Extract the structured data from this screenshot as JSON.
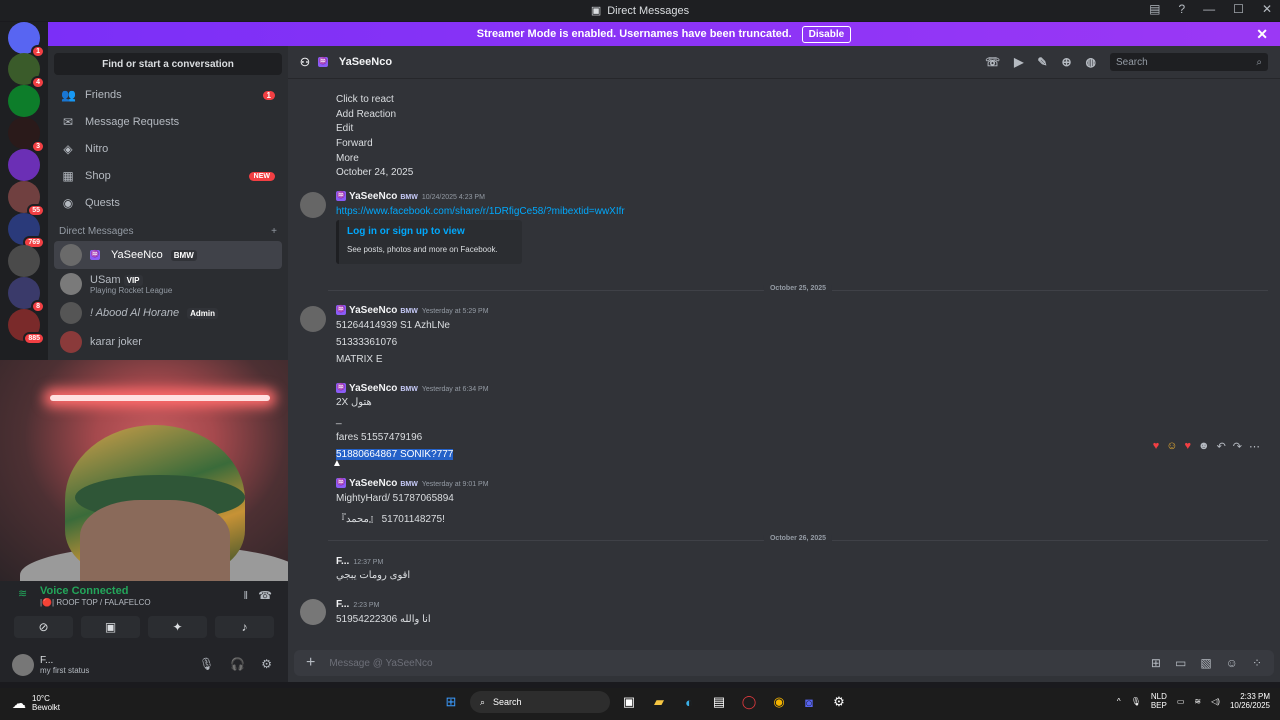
{
  "window": {
    "title": "Direct Messages"
  },
  "banner": {
    "text": "Streamer Mode is enabled. Usernames have been truncated.",
    "disable_label": "Disable"
  },
  "servers": [
    {
      "color": "#5865f2",
      "badge": "1"
    },
    {
      "color": "#3a5b2a",
      "badge": "4"
    },
    {
      "color": "#0d7d2a",
      "badge": ""
    },
    {
      "color": "#2a1a1a",
      "badge": "3"
    },
    {
      "color": "#6b2fb5",
      "badge": ""
    },
    {
      "color": "#704040",
      "badge": "55"
    },
    {
      "color": "#2a3a7a",
      "badge": "769"
    },
    {
      "color": "#4a4a4a",
      "badge": ""
    },
    {
      "color": "#3a3a6a",
      "badge": "8"
    },
    {
      "color": "#7a2a2a",
      "badge": "885"
    }
  ],
  "sidebar": {
    "find_placeholder": "Find or start a conversation",
    "nav": [
      {
        "label": "Friends",
        "badge": "1"
      },
      {
        "label": "Message Requests"
      },
      {
        "label": "Nitro"
      },
      {
        "label": "Shop",
        "new": "NEW"
      },
      {
        "label": "Quests"
      }
    ],
    "dm_header": "Direct Messages",
    "dms": [
      {
        "name": "YaSeeNco",
        "tag": "BMW",
        "sub": ""
      },
      {
        "name": "USam",
        "tag": "VIP",
        "sub": "Playing Rocket League"
      },
      {
        "name": "! Abood Al Horane",
        "tag": "Admin",
        "sub": ""
      },
      {
        "name": "karar joker",
        "tag": "",
        "sub": ""
      }
    ]
  },
  "voice": {
    "status": "Voice Connected",
    "channel": "|🔴| ROOF TOP / FALAFELCO",
    "user": "F...",
    "user_status": "my first status"
  },
  "chat": {
    "recipient": "YaSeeNco",
    "search_placeholder": "Search",
    "context_menu": [
      "Click to react",
      "Add Reaction",
      "Edit",
      "Forward",
      "More",
      "October 24, 2025"
    ],
    "msg1": {
      "user": "YaSeeNco",
      "badge": "BMW",
      "time": "10/24/2025 4:23 PM",
      "link": "https://www.facebook.com/share/r/1DRfigCe58/?mibextid=wwXIfr"
    },
    "embed": {
      "title": "Log in or sign up to view",
      "desc": "See posts, photos and more on Facebook."
    },
    "divider1": "October 25, 2025",
    "msg2": {
      "user": "YaSeeNco",
      "badge": "BMW",
      "time": "Yesterday at 5:29 PM",
      "lines": [
        "51264414939 S1 AzhLNe",
        "51333361076",
        "MATRIX E"
      ]
    },
    "msg3": {
      "user": "YaSeeNco",
      "badge": "BMW",
      "time": "Yesterday at 6:34 PM",
      "lines": [
        "2X هتول",
        "_",
        "fares 51557479196",
        "51880664867 SONIK?777"
      ]
    },
    "msg4": {
      "user": "YaSeeNco",
      "badge": "BMW",
      "time": "Yesterday at 9:01 PM",
      "lines": [
        "MightyHard/ 51787065894",
        "『محمد』 51701148275!"
      ]
    },
    "divider2": "October 26, 2025",
    "msg5": {
      "user": "F...",
      "time": "12:37 PM",
      "text": "اقوى رومات يبجي"
    },
    "msg6": {
      "user": "F...",
      "time": "2:23 PM",
      "text": "51954222306 انا والله"
    },
    "composer_placeholder": "Message @ YaSeeNco"
  },
  "taskbar": {
    "temp": "10°C",
    "weather": "Bewolkt",
    "search": "Search",
    "lang1": "NLD",
    "lang2": "BEP",
    "time": "2:33 PM",
    "date": "10/26/2025"
  }
}
